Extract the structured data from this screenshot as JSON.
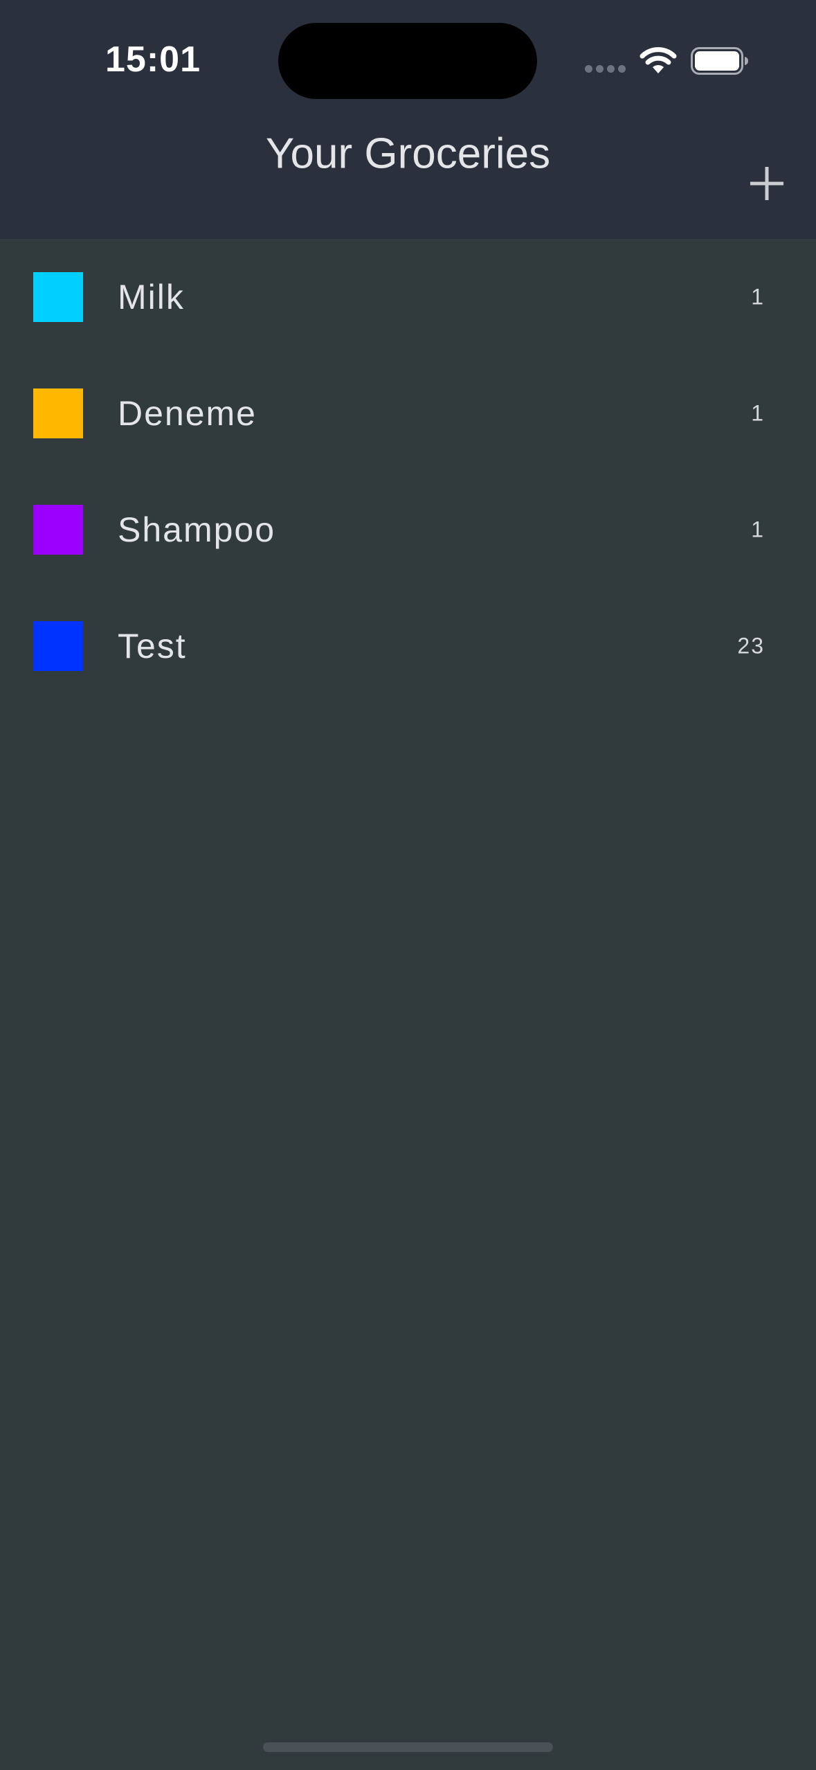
{
  "status_bar": {
    "time": "15:01"
  },
  "header": {
    "title": "Your Groceries",
    "add_icon": "plus-icon"
  },
  "groceries": [
    {
      "name": "Milk",
      "quantity": "1",
      "color": "#00d0ff"
    },
    {
      "name": "Deneme",
      "quantity": "1",
      "color": "#ffb700"
    },
    {
      "name": "Shampoo",
      "quantity": "1",
      "color": "#9b00ff"
    },
    {
      "name": "Test",
      "quantity": "23",
      "color": "#0033ff"
    }
  ],
  "colors": {
    "header_bg": "#2a313c",
    "list_bg": "#313a3c",
    "text": "#e3e5e8"
  }
}
